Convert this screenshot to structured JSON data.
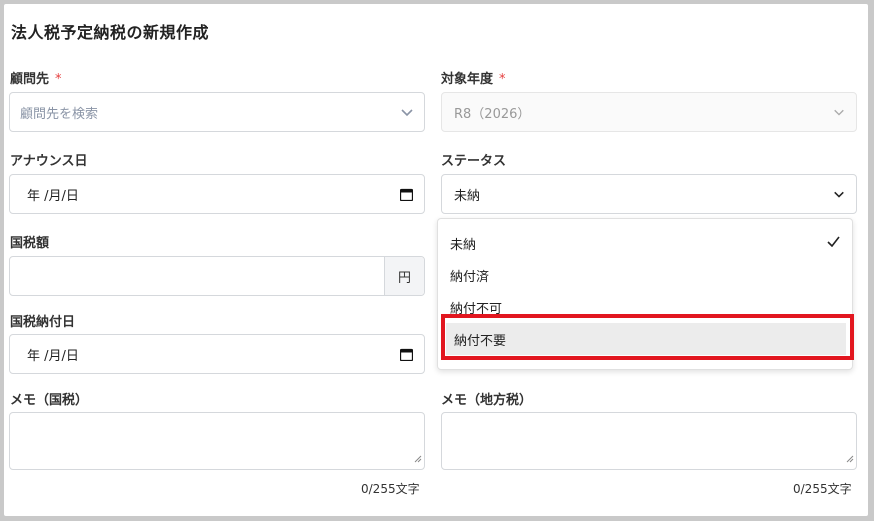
{
  "form": {
    "title": "法人税予定納税の新規作成"
  },
  "client": {
    "label": "顧問先",
    "required_mark": "*",
    "placeholder": "顧問先を検索"
  },
  "fiscal_year": {
    "label": "対象年度",
    "required_mark": "*",
    "value": "R8（2026）"
  },
  "announce_date": {
    "label": "アナウンス日",
    "value": "年 /月/日"
  },
  "status": {
    "label": "ステータス",
    "value": "未納",
    "options": [
      "未納",
      "納付済",
      "納付不可",
      "納付不要"
    ],
    "selected_index": 0,
    "hovered_index": 3
  },
  "national_tax": {
    "label": "国税額",
    "value": "",
    "unit": "円"
  },
  "national_tax_date": {
    "label": "国税納付日",
    "value": "年 /月/日"
  },
  "memo_national": {
    "label": "メモ（国税）",
    "value": "",
    "counter": "0/255文字"
  },
  "memo_local": {
    "label": "メモ（地方税）",
    "value": "",
    "counter": "0/255文字"
  },
  "colors": {
    "required": "#e53e3e",
    "highlight_box": "#e2161f",
    "hover_bg": "#ececec"
  }
}
